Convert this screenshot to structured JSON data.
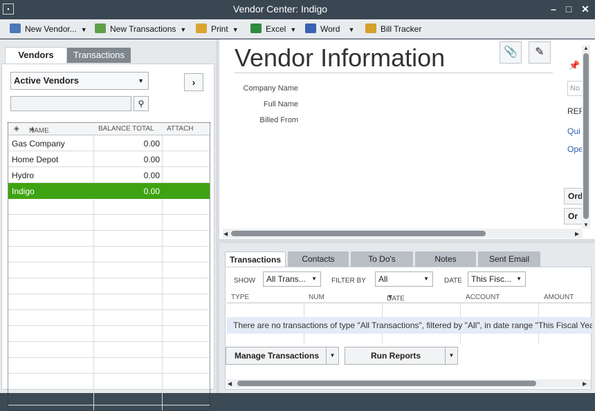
{
  "window": {
    "title": "Vendor Center: Indigo",
    "sys_icon": "▪"
  },
  "toolbar": {
    "new_vendor": "New Vendor...",
    "new_transactions": "New Transactions",
    "print": "Print",
    "excel": "Excel",
    "word": "Word",
    "bill_tracker": "Bill Tracker"
  },
  "left": {
    "tabs": {
      "vendors": "Vendors",
      "transactions": "Transactions"
    },
    "filter": "Active Vendors",
    "search": {
      "value": "",
      "placeholder": ""
    },
    "columns": {
      "name": "NAME",
      "balance": "BALANCE TOTAL",
      "attach": "ATTACH"
    },
    "rows": [
      {
        "name": "Gas Company",
        "balance": "0.00"
      },
      {
        "name": "Home Depot",
        "balance": "0.00"
      },
      {
        "name": "Hydro",
        "balance": "0.00"
      },
      {
        "name": "Indigo",
        "balance": "0.00"
      }
    ],
    "selected_index": 3
  },
  "info": {
    "title": "Vendor Information",
    "labels": {
      "company": "Company Name",
      "full": "Full Name",
      "billed": "Billed From"
    },
    "side": {
      "note_placeholder": "No",
      "ref": "REF",
      "quick": "Qui",
      "open": "Ope",
      "order": "Ord",
      "order2": "Or"
    }
  },
  "lower": {
    "tabs": [
      "Transactions",
      "Contacts",
      "To Do's",
      "Notes",
      "Sent Email"
    ],
    "filters": {
      "show_label": "SHOW",
      "show_value": "All Trans...",
      "filter_label": "FILTER BY",
      "filter_value": "All",
      "date_label": "DATE",
      "date_value": "This Fisc..."
    },
    "columns": [
      "TYPE",
      "NUM",
      "DATE",
      "ACCOUNT",
      "AMOUNT"
    ],
    "empty_message": "There are no transactions of type \"All Transactions\", filtered by \"All\", in date range \"This Fiscal Year\"",
    "buttons": {
      "manage": "Manage Transactions",
      "reports": "Run Reports"
    }
  },
  "colors": {
    "selected_row": "#3ea312",
    "titlebar": "#3a4652"
  }
}
